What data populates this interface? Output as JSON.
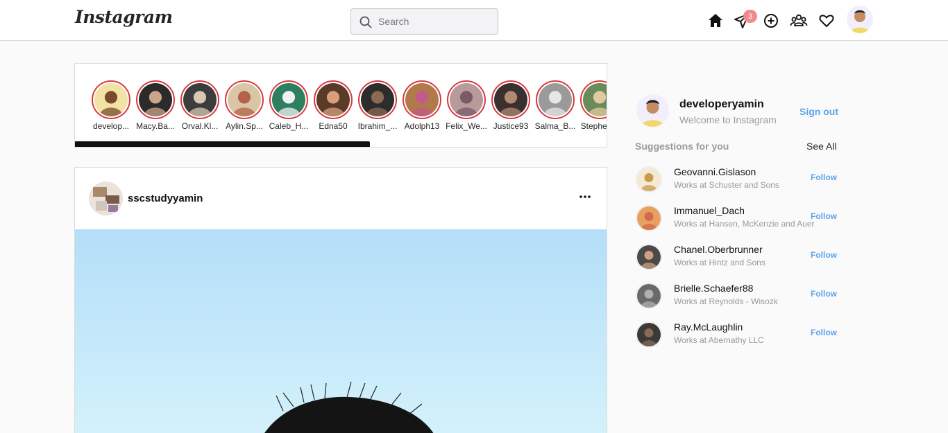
{
  "header": {
    "logo": "Instagram",
    "search_placeholder": "Search",
    "messages_badge": "3"
  },
  "stories": [
    {
      "name": "develop...",
      "bg": "#f1e3a6",
      "fg": "#7a4a2a"
    },
    {
      "name": "Macy.Ba...",
      "bg": "#2b2b2b",
      "fg": "#caa58a"
    },
    {
      "name": "Orval.Kl...",
      "bg": "#3c3c3c",
      "fg": "#d9c7b3"
    },
    {
      "name": "Aylin.Sp...",
      "bg": "#d8c6a6",
      "fg": "#b4624a"
    },
    {
      "name": "Caleb_H...",
      "bg": "#2e7f5f",
      "fg": "#f1f1f1"
    },
    {
      "name": "Edna50",
      "bg": "#5a3b2a",
      "fg": "#d8a07a"
    },
    {
      "name": "Ibrahim_...",
      "bg": "#2d2d2d",
      "fg": "#8a6a52"
    },
    {
      "name": "Adolph13",
      "bg": "#b07a4a",
      "fg": "#c25a8a"
    },
    {
      "name": "Felix_We...",
      "bg": "#b89a9a",
      "fg": "#7a5a6a"
    },
    {
      "name": "Justice93",
      "bg": "#3a3030",
      "fg": "#b08a72"
    },
    {
      "name": "Salma_B...",
      "bg": "#9a9a9a",
      "fg": "#e6e6e6"
    },
    {
      "name": "Stephen...",
      "bg": "#6a8a5a",
      "fg": "#e3c9a0"
    }
  ],
  "post": {
    "username": "sscstudyyamin",
    "sky_top": "#b4def8",
    "sky_bottom": "#d6f3fb"
  },
  "sidebar": {
    "username": "developeryamin",
    "welcome": "Welcome to Instagram",
    "signout": "Sign out",
    "suggestions_title": "Suggestions for you",
    "see_all": "See All",
    "follow_label": "Follow",
    "suggestions": [
      {
        "name": "Geovanni.Gislason",
        "desc": "Works at Schuster and Sons",
        "bg": "#f5e9d6",
        "fg": "#c89a4a"
      },
      {
        "name": "Immanuel_Dach",
        "desc": "Works at Hansen, McKenzie and Auer",
        "bg": "#e8a060",
        "fg": "#d06a4a"
      },
      {
        "name": "Chanel.Oberbrunner",
        "desc": "Works at Hintz and Sons",
        "bg": "#4a4a4a",
        "fg": "#d0a080"
      },
      {
        "name": "Brielle.Schaefer88",
        "desc": "Works at Reynolds - Wisozk",
        "bg": "#6a6a6a",
        "fg": "#b0b0b0"
      },
      {
        "name": "Ray.McLaughlin",
        "desc": "Works at Abernathy LLC",
        "bg": "#3a3a3a",
        "fg": "#8a6a52"
      }
    ]
  }
}
